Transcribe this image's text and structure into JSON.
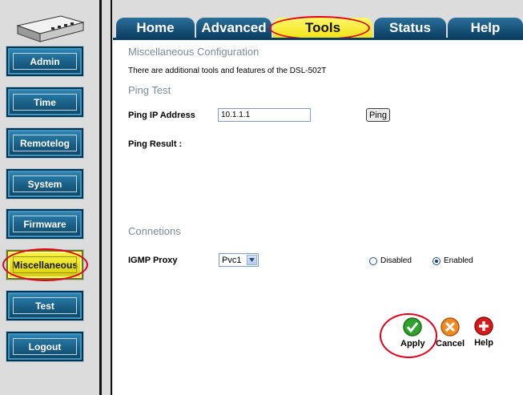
{
  "sidebar": {
    "device_icon": "dsl-router-icon",
    "items": [
      {
        "label": "Admin"
      },
      {
        "label": "Time"
      },
      {
        "label": "Remotelog"
      },
      {
        "label": "System"
      },
      {
        "label": "Firmware"
      },
      {
        "label": "Miscellaneous",
        "active": true
      },
      {
        "label": "Test"
      },
      {
        "label": "Logout"
      }
    ]
  },
  "tabs": [
    {
      "label": "Home"
    },
    {
      "label": "Advanced"
    },
    {
      "label": "Tools",
      "active": true
    },
    {
      "label": "Status"
    },
    {
      "label": "Help"
    }
  ],
  "page": {
    "title": "Miscellaneous Configuration",
    "description": "There are additional tools and features of the DSL-502T"
  },
  "ping": {
    "section_title": "Ping Test",
    "ip_label": "Ping IP Address",
    "ip_value": "10.1.1.1",
    "button_label": "Ping",
    "result_label": "Ping Result :"
  },
  "connections": {
    "section_title": "Connetions",
    "igmp_label": "IGMP Proxy",
    "pvc_selected": "Pvc1",
    "disabled_label": "Disabled",
    "enabled_label": "Enabled",
    "selected": "Enabled"
  },
  "actions": {
    "apply_label": "Apply",
    "cancel_label": "Cancel",
    "help_label": "Help"
  },
  "colors": {
    "nav_blue": "#1a5f86",
    "tab_blue": "#0c3f63",
    "active_yellow": "#f2e21a",
    "highlight_red": "#e0001b",
    "apply_green": "#2fa12f",
    "cancel_orange": "#f08a24",
    "help_red": "#d81a1a"
  }
}
